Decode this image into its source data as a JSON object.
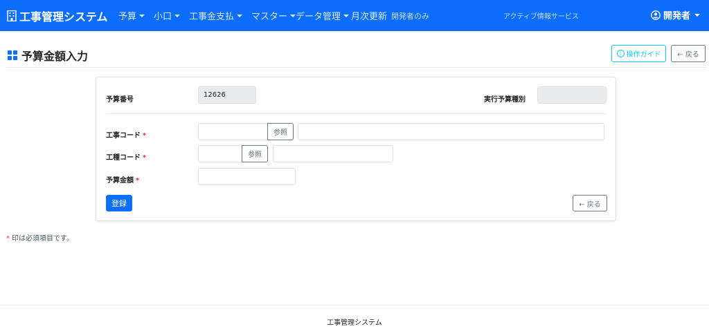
{
  "navbar": {
    "brand": "工事管理システム",
    "items": [
      {
        "label": "予算"
      },
      {
        "label": "小口"
      },
      {
        "label": "工事金支払"
      },
      {
        "label": "マスター"
      },
      {
        "label": "データ管理"
      }
    ],
    "monthly": {
      "label": "月次更新",
      "sub": "開発者のみ"
    },
    "info": "アクティブ情報サービス",
    "user": "開発者"
  },
  "page": {
    "title": "予算金額入力",
    "guide_label": "操作ガイド",
    "back_label": "← 戻る"
  },
  "form": {
    "budget_no_label": "予算番号",
    "budget_no_value": "12626",
    "budget_type_label": "実行予算種別",
    "budget_type_value": "",
    "koji_code_label": "工事コード",
    "koji_code_value": "",
    "koji_name_value": "",
    "kushu_code_label": "工種コード",
    "kushu_code_value": "",
    "kushu_name_value": "",
    "amount_label": "予算金額",
    "amount_value": "",
    "required_mark": "*",
    "ref_label": "参照",
    "submit_label": "登録",
    "back_label": "← 戻る"
  },
  "note": {
    "mark": "*",
    "text": "印は必須項目です。"
  },
  "footer": {
    "text": "工事管理システム"
  },
  "colors": {
    "primary": "#0d6efd",
    "info": "#0dcaf0",
    "danger": "#dc3545",
    "secondary": "#6c757d"
  }
}
